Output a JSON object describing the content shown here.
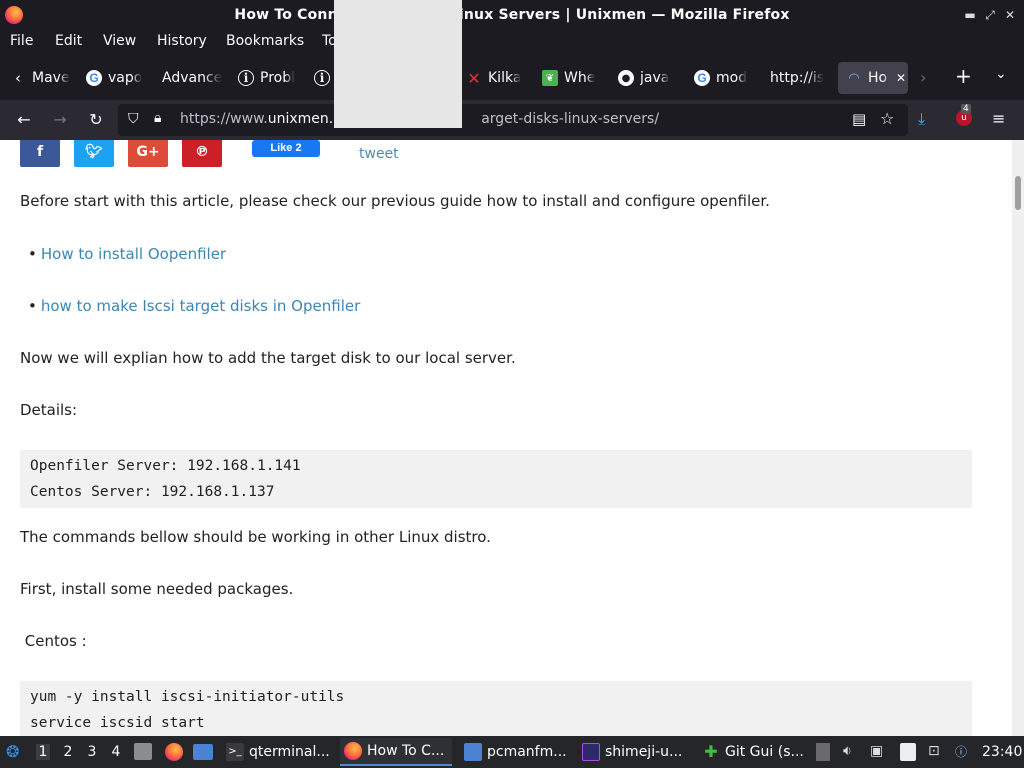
{
  "window": {
    "title": "How To Connect Ar... Onto Linux Servers | Unixmen — Mozilla Firefox"
  },
  "menu": [
    "File",
    "Edit",
    "View",
    "History",
    "Bookmarks",
    "To"
  ],
  "tabs": [
    {
      "label": "Mave",
      "icon": "back-chevron-icon"
    },
    {
      "label": "vapo",
      "icon": "google-icon"
    },
    {
      "label": "Advance",
      "icon": ""
    },
    {
      "label": "Probl",
      "icon": "info-icon"
    },
    {
      "label": "",
      "icon": "info-icon"
    },
    {
      "label": "Kilka",
      "icon": "red-x-icon"
    },
    {
      "label": "Whe",
      "icon": "leaf-icon"
    },
    {
      "label": "java",
      "icon": "github-icon"
    },
    {
      "label": "mod",
      "icon": "google-icon"
    },
    {
      "label": "http://is",
      "icon": ""
    },
    {
      "label": "Ho",
      "icon": "unixmen-icon"
    }
  ],
  "nav": {
    "url_prefix": "https://www.",
    "url_domain": "unixmen.",
    "url_suffix": "arget-disks-linux-servers/",
    "downloads_badge": "4"
  },
  "page": {
    "share_tweet": "tweet",
    "fb_like": "Like 2",
    "intro": "Before start with this article, please check our previous guide how to install and configure openfiler.",
    "links": [
      "How  to install Oopenfiler",
      "how to make Iscsi target disks in Openfiler"
    ],
    "now": "Now we will explian how to add the target disk to our local server.",
    "details": "Details:",
    "details_code": [
      "Openfiler Server: 192.168.1.141",
      "Centos Server: 192.168.1.137"
    ],
    "commands": "The commands bellow should be working in other Linux distro.",
    "first": "First, install some needed packages.",
    "centos": " Centos :",
    "install_code": [
      "yum -y install iscsi-initiator-utils",
      "service iscsid start"
    ]
  },
  "taskbar": {
    "workspaces": [
      "1",
      "2",
      "3",
      "4"
    ],
    "tasks": [
      "qterminal...",
      "How To C...",
      "pcmanfm...",
      "shimeji-u...",
      "Git Gui (s..."
    ],
    "clock": "23:40"
  }
}
